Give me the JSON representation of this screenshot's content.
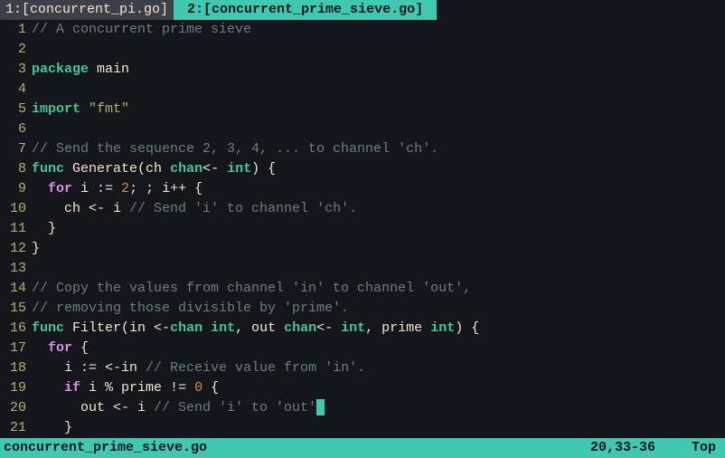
{
  "tabs": [
    {
      "label": "1:[concurrent_pi.go]",
      "active": false
    },
    {
      "label": " 2:[concurrent_prime_sieve.go] ",
      "active": true
    }
  ],
  "lines": [
    [
      {
        "c": "cmt",
        "t": "// A concurrent prime sieve"
      }
    ],
    [
      {
        "c": "",
        "t": ""
      }
    ],
    [
      {
        "c": "kw",
        "t": "package"
      },
      {
        "c": "",
        "t": " "
      },
      {
        "c": "id",
        "t": "main"
      }
    ],
    [
      {
        "c": "",
        "t": ""
      }
    ],
    [
      {
        "c": "kw",
        "t": "import"
      },
      {
        "c": "",
        "t": " "
      },
      {
        "c": "str",
        "t": "\"fmt\""
      }
    ],
    [
      {
        "c": "",
        "t": ""
      }
    ],
    [
      {
        "c": "cmt",
        "t": "// Send the sequence 2, 3, 4, ... to channel 'ch'."
      }
    ],
    [
      {
        "c": "kw",
        "t": "func"
      },
      {
        "c": "",
        "t": " "
      },
      {
        "c": "fn",
        "t": "Generate(ch "
      },
      {
        "c": "typ",
        "t": "chan"
      },
      {
        "c": "op",
        "t": "<- "
      },
      {
        "c": "typ",
        "t": "int"
      },
      {
        "c": "",
        "t": ") {"
      }
    ],
    [
      {
        "c": "",
        "t": "  "
      },
      {
        "c": "kw2",
        "t": "for"
      },
      {
        "c": "",
        "t": " i := "
      },
      {
        "c": "num",
        "t": "2"
      },
      {
        "c": "",
        "t": "; ; i++ {"
      }
    ],
    [
      {
        "c": "",
        "t": "    ch <- i "
      },
      {
        "c": "cmt",
        "t": "// Send 'i' to channel 'ch'."
      }
    ],
    [
      {
        "c": "",
        "t": "  }"
      }
    ],
    [
      {
        "c": "",
        "t": "}"
      }
    ],
    [
      {
        "c": "",
        "t": ""
      }
    ],
    [
      {
        "c": "cmt",
        "t": "// Copy the values from channel 'in' to channel 'out',"
      }
    ],
    [
      {
        "c": "cmt",
        "t": "// removing those divisible by 'prime'."
      }
    ],
    [
      {
        "c": "kw",
        "t": "func"
      },
      {
        "c": "",
        "t": " "
      },
      {
        "c": "fn",
        "t": "Filter(in <-"
      },
      {
        "c": "typ",
        "t": "chan"
      },
      {
        "c": "",
        "t": " "
      },
      {
        "c": "typ",
        "t": "int"
      },
      {
        "c": "",
        "t": ", out "
      },
      {
        "c": "typ",
        "t": "chan"
      },
      {
        "c": "op",
        "t": "<- "
      },
      {
        "c": "typ",
        "t": "int"
      },
      {
        "c": "",
        "t": ", prime "
      },
      {
        "c": "typ",
        "t": "int"
      },
      {
        "c": "",
        "t": ") {"
      }
    ],
    [
      {
        "c": "",
        "t": "  "
      },
      {
        "c": "kw2",
        "t": "for"
      },
      {
        "c": "",
        "t": " {"
      }
    ],
    [
      {
        "c": "",
        "t": "    i := <-in "
      },
      {
        "c": "cmt",
        "t": "// Receive value from 'in'."
      }
    ],
    [
      {
        "c": "",
        "t": "    "
      },
      {
        "c": "kw2",
        "t": "if"
      },
      {
        "c": "",
        "t": " i % prime != "
      },
      {
        "c": "num",
        "t": "0"
      },
      {
        "c": "",
        "t": " {"
      }
    ],
    [
      {
        "c": "",
        "t": "      out <- i "
      },
      {
        "c": "cmt",
        "t": "// Send 'i' to 'out'"
      },
      {
        "c": "cursor",
        "t": ""
      },
      {
        "c": "cmt",
        "t": ""
      }
    ],
    [
      {
        "c": "",
        "t": "    }"
      }
    ]
  ],
  "status": {
    "filename": "concurrent_prime_sieve.go",
    "position": "20,33-36",
    "scroll": "Top"
  }
}
